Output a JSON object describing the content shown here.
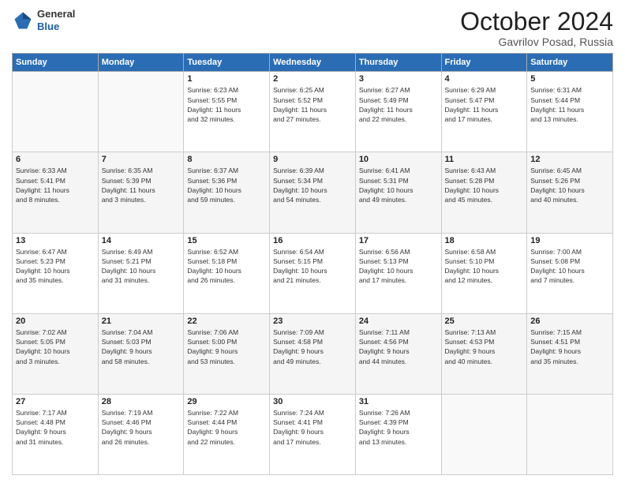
{
  "logo": {
    "general": "General",
    "blue": "Blue"
  },
  "title": "October 2024",
  "location": "Gavrilov Posad, Russia",
  "days_header": [
    "Sunday",
    "Monday",
    "Tuesday",
    "Wednesday",
    "Thursday",
    "Friday",
    "Saturday"
  ],
  "weeks": [
    [
      {
        "day": "",
        "detail": ""
      },
      {
        "day": "",
        "detail": ""
      },
      {
        "day": "1",
        "detail": "Sunrise: 6:23 AM\nSunset: 5:55 PM\nDaylight: 11 hours\nand 32 minutes."
      },
      {
        "day": "2",
        "detail": "Sunrise: 6:25 AM\nSunset: 5:52 PM\nDaylight: 11 hours\nand 27 minutes."
      },
      {
        "day": "3",
        "detail": "Sunrise: 6:27 AM\nSunset: 5:49 PM\nDaylight: 11 hours\nand 22 minutes."
      },
      {
        "day": "4",
        "detail": "Sunrise: 6:29 AM\nSunset: 5:47 PM\nDaylight: 11 hours\nand 17 minutes."
      },
      {
        "day": "5",
        "detail": "Sunrise: 6:31 AM\nSunset: 5:44 PM\nDaylight: 11 hours\nand 13 minutes."
      }
    ],
    [
      {
        "day": "6",
        "detail": "Sunrise: 6:33 AM\nSunset: 5:41 PM\nDaylight: 11 hours\nand 8 minutes."
      },
      {
        "day": "7",
        "detail": "Sunrise: 6:35 AM\nSunset: 5:39 PM\nDaylight: 11 hours\nand 3 minutes."
      },
      {
        "day": "8",
        "detail": "Sunrise: 6:37 AM\nSunset: 5:36 PM\nDaylight: 10 hours\nand 59 minutes."
      },
      {
        "day": "9",
        "detail": "Sunrise: 6:39 AM\nSunset: 5:34 PM\nDaylight: 10 hours\nand 54 minutes."
      },
      {
        "day": "10",
        "detail": "Sunrise: 6:41 AM\nSunset: 5:31 PM\nDaylight: 10 hours\nand 49 minutes."
      },
      {
        "day": "11",
        "detail": "Sunrise: 6:43 AM\nSunset: 5:28 PM\nDaylight: 10 hours\nand 45 minutes."
      },
      {
        "day": "12",
        "detail": "Sunrise: 6:45 AM\nSunset: 5:26 PM\nDaylight: 10 hours\nand 40 minutes."
      }
    ],
    [
      {
        "day": "13",
        "detail": "Sunrise: 6:47 AM\nSunset: 5:23 PM\nDaylight: 10 hours\nand 35 minutes."
      },
      {
        "day": "14",
        "detail": "Sunrise: 6:49 AM\nSunset: 5:21 PM\nDaylight: 10 hours\nand 31 minutes."
      },
      {
        "day": "15",
        "detail": "Sunrise: 6:52 AM\nSunset: 5:18 PM\nDaylight: 10 hours\nand 26 minutes."
      },
      {
        "day": "16",
        "detail": "Sunrise: 6:54 AM\nSunset: 5:15 PM\nDaylight: 10 hours\nand 21 minutes."
      },
      {
        "day": "17",
        "detail": "Sunrise: 6:56 AM\nSunset: 5:13 PM\nDaylight: 10 hours\nand 17 minutes."
      },
      {
        "day": "18",
        "detail": "Sunrise: 6:58 AM\nSunset: 5:10 PM\nDaylight: 10 hours\nand 12 minutes."
      },
      {
        "day": "19",
        "detail": "Sunrise: 7:00 AM\nSunset: 5:08 PM\nDaylight: 10 hours\nand 7 minutes."
      }
    ],
    [
      {
        "day": "20",
        "detail": "Sunrise: 7:02 AM\nSunset: 5:05 PM\nDaylight: 10 hours\nand 3 minutes."
      },
      {
        "day": "21",
        "detail": "Sunrise: 7:04 AM\nSunset: 5:03 PM\nDaylight: 9 hours\nand 58 minutes."
      },
      {
        "day": "22",
        "detail": "Sunrise: 7:06 AM\nSunset: 5:00 PM\nDaylight: 9 hours\nand 53 minutes."
      },
      {
        "day": "23",
        "detail": "Sunrise: 7:09 AM\nSunset: 4:58 PM\nDaylight: 9 hours\nand 49 minutes."
      },
      {
        "day": "24",
        "detail": "Sunrise: 7:11 AM\nSunset: 4:56 PM\nDaylight: 9 hours\nand 44 minutes."
      },
      {
        "day": "25",
        "detail": "Sunrise: 7:13 AM\nSunset: 4:53 PM\nDaylight: 9 hours\nand 40 minutes."
      },
      {
        "day": "26",
        "detail": "Sunrise: 7:15 AM\nSunset: 4:51 PM\nDaylight: 9 hours\nand 35 minutes."
      }
    ],
    [
      {
        "day": "27",
        "detail": "Sunrise: 7:17 AM\nSunset: 4:48 PM\nDaylight: 9 hours\nand 31 minutes."
      },
      {
        "day": "28",
        "detail": "Sunrise: 7:19 AM\nSunset: 4:46 PM\nDaylight: 9 hours\nand 26 minutes."
      },
      {
        "day": "29",
        "detail": "Sunrise: 7:22 AM\nSunset: 4:44 PM\nDaylight: 9 hours\nand 22 minutes."
      },
      {
        "day": "30",
        "detail": "Sunrise: 7:24 AM\nSunset: 4:41 PM\nDaylight: 9 hours\nand 17 minutes."
      },
      {
        "day": "31",
        "detail": "Sunrise: 7:26 AM\nSunset: 4:39 PM\nDaylight: 9 hours\nand 13 minutes."
      },
      {
        "day": "",
        "detail": ""
      },
      {
        "day": "",
        "detail": ""
      }
    ]
  ]
}
